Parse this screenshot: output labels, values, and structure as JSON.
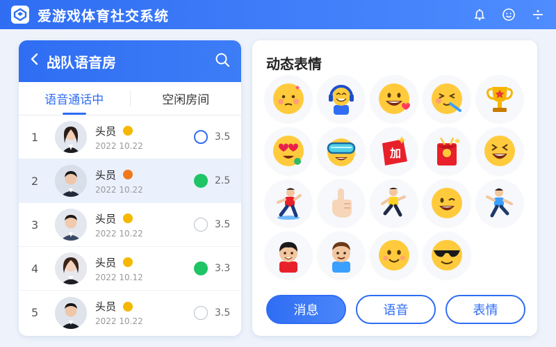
{
  "app": {
    "title": "爱游戏体育社交系统"
  },
  "room": {
    "title": "战队语音房",
    "tabs": [
      {
        "label": "语音通话中",
        "active": true
      },
      {
        "label": "空闲房间",
        "active": false
      }
    ],
    "members": [
      {
        "index": "1",
        "name": "头员",
        "date": "2022 10.22",
        "status_color": "#f5b800",
        "mic_state": "outline-blue",
        "score": "3.5"
      },
      {
        "index": "2",
        "name": "头员",
        "date": "2022 10.22",
        "status_color": "#f07a1a",
        "mic_state": "green",
        "score": "2.5"
      },
      {
        "index": "3",
        "name": "头员",
        "date": "2022 10.22",
        "status_color": "#f5b800",
        "mic_state": "outline-gray",
        "score": "3.5"
      },
      {
        "index": "4",
        "name": "头员",
        "date": "2022 10.12",
        "status_color": "#f5b800",
        "mic_state": "green",
        "score": "3.3"
      },
      {
        "index": "5",
        "name": "头员",
        "date": "2022 10.22",
        "status_color": "#f5b800",
        "mic_state": "outline-gray",
        "score": "3.5"
      }
    ]
  },
  "emoji_panel": {
    "title": "动态表情",
    "icons": [
      "blushing-face-icon",
      "headphones-gamer-icon",
      "grinning-face-icon",
      "squinting-face-icon",
      "trophy-icon",
      "heart-eyes-face-icon",
      "goggles-face-icon",
      "jia-sticker-icon",
      "red-envelope-icon",
      "laughing-face-icon",
      "runner-icon",
      "pointing-finger-icon",
      "jogger-icon",
      "winking-face-icon",
      "dancer-icon",
      "athlete-boy-icon",
      "athlete-man-icon",
      "smiling-face-icon",
      "sunglasses-face-icon"
    ],
    "jia_label": "加"
  },
  "actions": {
    "message": "消息",
    "voice": "语音",
    "emoji": "表情"
  },
  "colors": {
    "accent": "#2f6df3",
    "online": "#1fc465"
  }
}
